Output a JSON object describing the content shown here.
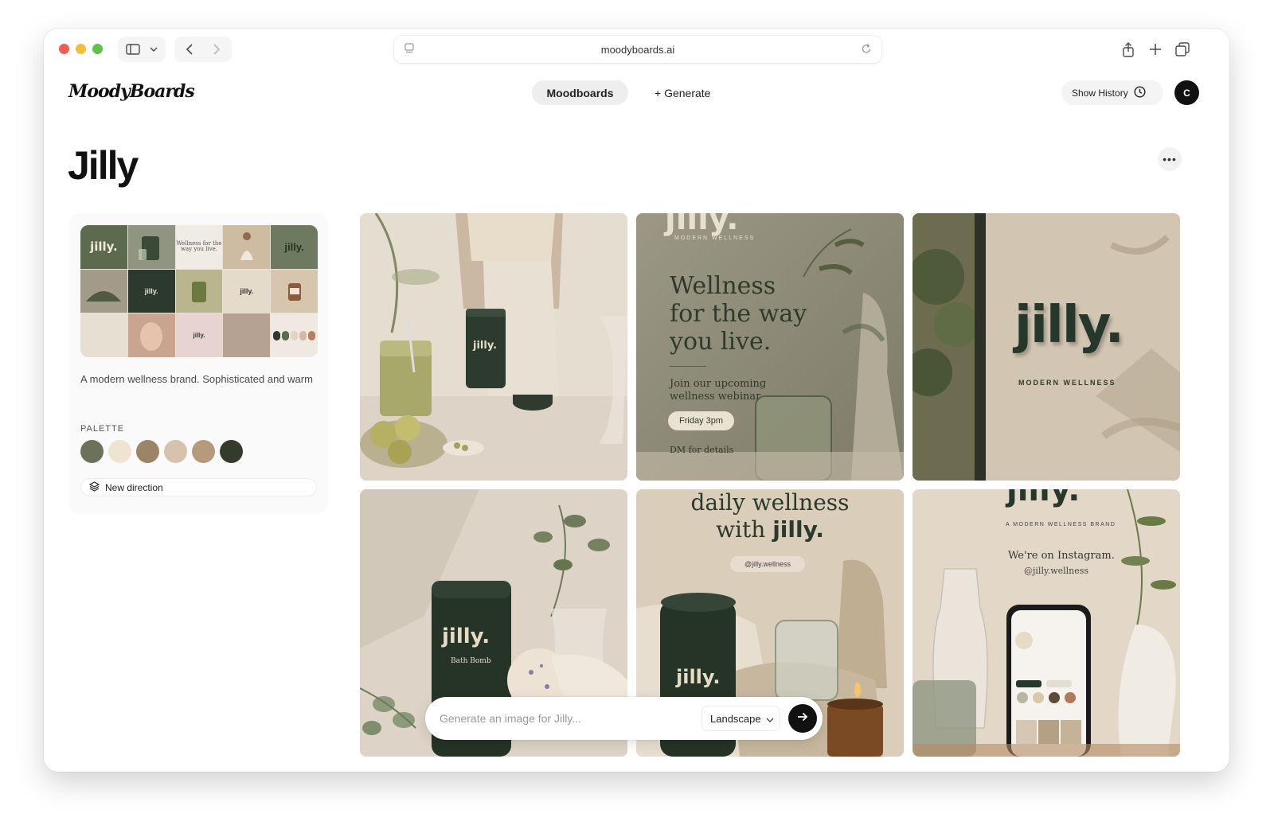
{
  "browser": {
    "url": "moodyboards.ai",
    "icons": [
      "sidebar-icon",
      "chevron-down-icon",
      "back-icon",
      "forward-icon",
      "page-icon",
      "reload-icon",
      "share-icon",
      "plus-icon",
      "tabs-icon"
    ]
  },
  "header": {
    "logo": "MoodyBoards",
    "nav": {
      "moodboards": "Moodboards",
      "generate": "+ Generate"
    },
    "history_label": "Show History",
    "avatar_initial": "C"
  },
  "board": {
    "title": "Jilly",
    "more_label": "•••",
    "description": "A modern wellness brand. Sophisticated and warm",
    "palette_label": "PALETTE",
    "palette": [
      "#6b715b",
      "#efe4d2",
      "#9a8567",
      "#d5c3ae",
      "#b59a7b",
      "#343a2c"
    ],
    "new_direction_label": "New direction",
    "collage_texts": {
      "brand": "jilly.",
      "tagline": "Wellness for the way you live."
    }
  },
  "tiles": {
    "t1": {
      "brand": "jilly."
    },
    "t2": {
      "brand": "jilly.",
      "tag": "MODERN WELLNESS",
      "headline_1": "Wellness",
      "headline_2": "for the way",
      "headline_3": "you live.",
      "sub_1": "Join our upcoming",
      "sub_2": "wellness webinar",
      "pill": "Friday 3pm",
      "dm": "DM for details"
    },
    "t3": {
      "brand": "jilly.",
      "tag": "MODERN WELLNESS"
    },
    "t4": {
      "brand": "jilly.",
      "product": "Bath Bomb"
    },
    "t5": {
      "line1": "daily wellness",
      "line2_prefix": "with ",
      "line2_brand": "jilly.",
      "handle": "@jilly.wellness",
      "jar_brand": "jilly."
    },
    "t6": {
      "brand": "jilly.",
      "tag": "A MODERN WELLNESS BRAND",
      "line1": "We're on Instagram.",
      "line2": "@jilly.wellness"
    }
  },
  "prompt": {
    "placeholder": "Generate an image for Jilly...",
    "orientation": "Landscape"
  }
}
